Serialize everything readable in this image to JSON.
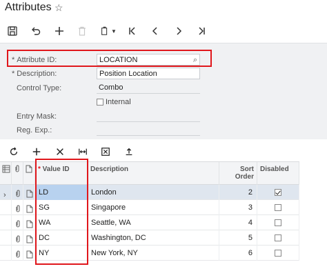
{
  "title_bar": {
    "title": "Attributes"
  },
  "form": {
    "attribute_id": {
      "label": "Attribute ID:",
      "value": "LOCATION"
    },
    "description": {
      "label": "Description:",
      "value": "Position Location"
    },
    "control_type": {
      "label": "Control Type:",
      "value": "Combo"
    },
    "internal": {
      "label": "Internal",
      "checked": false
    },
    "entry_mask": {
      "label": "Entry Mask:",
      "value": ""
    },
    "reg_exp": {
      "label": "Reg. Exp.:",
      "value": ""
    }
  },
  "grid": {
    "columns": {
      "value_id": "Value ID",
      "description": "Description",
      "sort_order": "Sort Order",
      "disabled": "Disabled"
    },
    "rows": [
      {
        "value_id": "LD",
        "description": "London",
        "sort_order": "2",
        "disabled": true
      },
      {
        "value_id": "SG",
        "description": "Singapore",
        "sort_order": "3",
        "disabled": false
      },
      {
        "value_id": "WA",
        "description": "Seattle, WA",
        "sort_order": "4",
        "disabled": false
      },
      {
        "value_id": "DC",
        "description": "Washington, DC",
        "sort_order": "5",
        "disabled": false
      },
      {
        "value_id": "NY",
        "description": "New York, NY",
        "sort_order": "6",
        "disabled": false
      }
    ]
  },
  "colors": {
    "highlight": "#e0161b",
    "selected_row": "#dfe6ef",
    "active_cell": "#b8d2ef"
  }
}
